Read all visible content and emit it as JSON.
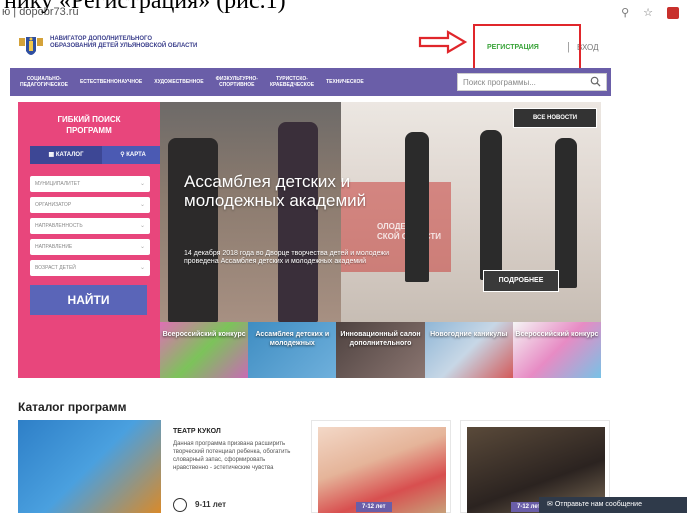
{
  "doc_caption": "нику «Регистрация» (рис.1)",
  "browser": {
    "url": "dopobr73.ru",
    "url_prefix": "ю |"
  },
  "header": {
    "logo_text": "Навигатор дополнительного образования детей Ульяновской области",
    "register": "Регистрация",
    "separator": "|",
    "login": "вход"
  },
  "nav": {
    "items": [
      "Социально-\nпедагогическое",
      "Естественнонаучное",
      "Художественное",
      "Физкультурно-\nспортивное",
      "Туристско-\nкраеведческое",
      "Техническое"
    ],
    "search_placeholder": "Поиск программы..."
  },
  "filter": {
    "title": "Гибкий поиск\nпрограмм",
    "tab_catalog": "Каталог",
    "tab_map": "Карта",
    "selects": [
      "Муниципалитет",
      "Организатор",
      "Направленность",
      "Направление",
      "Возраст детей"
    ],
    "find": "Найти"
  },
  "banner": {
    "all_news": "Все новости",
    "title": "Ассамблея детских и молодежных академий",
    "subtitle": "14 декабря 2018 года во Дворце творчества детей и молодежи проведена Ассамблея детских и молодежных академий",
    "more": "Подробнее",
    "screen_text": "ОЛОДЕЖНЫ\nСКОЙ ОБЛАСТИ"
  },
  "thumbs": [
    {
      "label": "Всероссийский конкурс",
      "color": "#c86bb4"
    },
    {
      "label": "Ассамблея детских и молодежных",
      "color": "#4a98c8"
    },
    {
      "label": "Инновационный салон дополнительного",
      "color": "#6b5a52"
    },
    {
      "label": "Новогодние каникулы",
      "color": "#8fb6d6"
    },
    {
      "label": "Всероссийский конкурс",
      "color": "#d89ac2"
    }
  ],
  "catalog": {
    "title": "Каталог программ",
    "card1": {
      "title": "Театр кукол",
      "desc": "Данная программа призвана расширить творческий потенциал ребенка, обогатить словарный запас, сформировать нравственно - эстетические чувства",
      "age": "9-11 лет"
    },
    "card2_age": "7-12 лет",
    "card3_age": "7-12 лет"
  },
  "chat": {
    "label": "Отправьте нам сообщение"
  }
}
